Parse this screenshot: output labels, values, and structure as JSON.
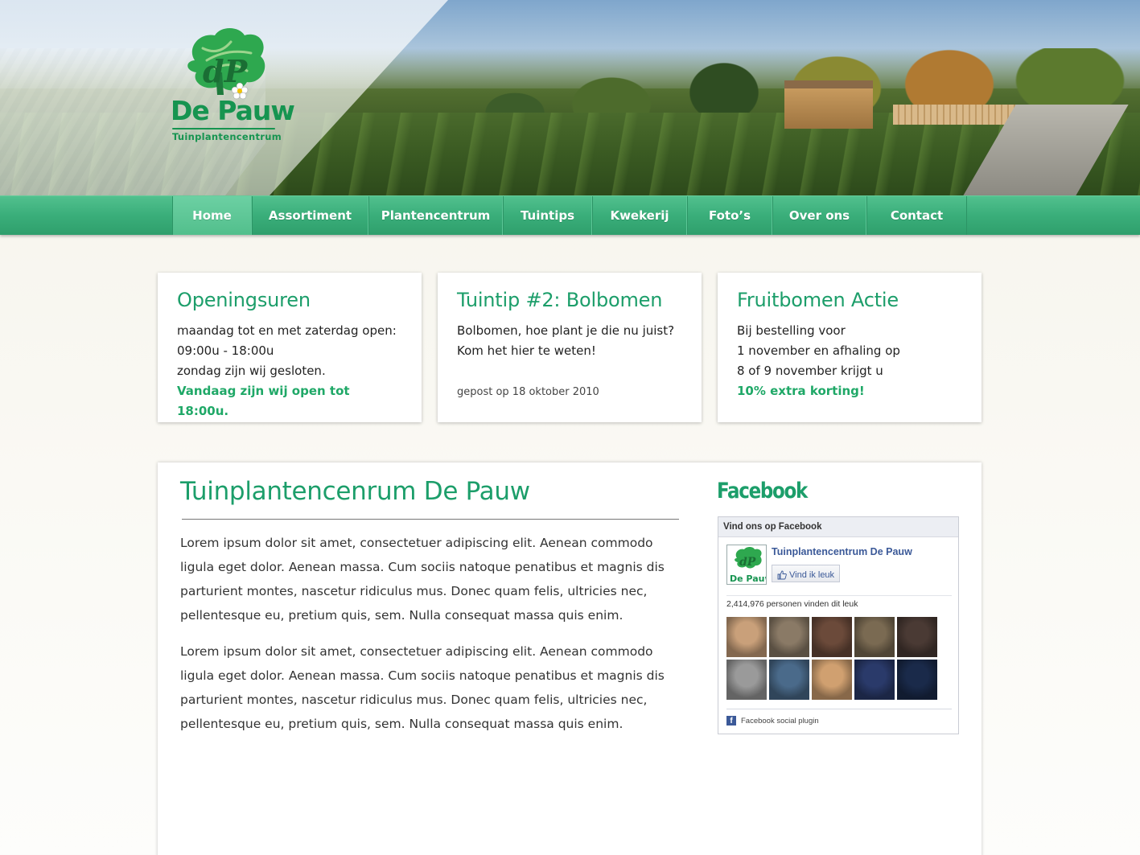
{
  "brand": {
    "name": "De Pauw",
    "subtitle": "Tuinplantencentrum",
    "monogram": "dP",
    "logo_icon": "tree-flower-logo-icon",
    "color": "#169450"
  },
  "nav": {
    "items": [
      {
        "label": "Home",
        "active": true
      },
      {
        "label": "Assortiment"
      },
      {
        "label": "Plantencentrum"
      },
      {
        "label": "Tuintips"
      },
      {
        "label": "Kwekerij"
      },
      {
        "label": "Foto’s"
      },
      {
        "label": "Over ons"
      },
      {
        "label": "Contact"
      }
    ],
    "color": "#3aae7a"
  },
  "cards": {
    "hours": {
      "title": "Openingsuren",
      "line1": "maandag tot en met zaterdag open:",
      "line2": "09:00u - 18:00u",
      "line3": "zondag zijn wij gesloten.",
      "highlight": "Vandaag zijn wij open tot 18:00u."
    },
    "tip": {
      "title": "Tuintip #2: Bolbomen",
      "line1": "Bolbomen, hoe plant je die nu juist?",
      "line2": "Kom het hier te weten!",
      "meta": "gepost op 18 oktober 2010"
    },
    "promo": {
      "title": "Fruitbomen Actie",
      "line1": "Bij bestelling voor",
      "line2": "1 november en afhaling op",
      "line3": "8 of 9 november krijgt u",
      "highlight": "10% extra korting!"
    }
  },
  "main": {
    "title": "Tuinplantencenrum De Pauw",
    "paragraphs": [
      "Lorem ipsum dolor sit amet, consectetuer adipiscing elit. Aenean commodo ligula eget dolor. Aenean massa. Cum sociis natoque penatibus et magnis dis parturient montes, nascetur ridiculus mus. Donec quam felis, ultricies nec, pellentesque eu, pretium quis, sem. Nulla consequat massa quis enim.",
      "Lorem ipsum dolor sit amet, consectetuer adipiscing elit. Aenean commodo ligula eget dolor. Aenean massa. Cum sociis natoque penatibus et magnis dis parturient montes, nascetur ridiculus mus. Donec quam felis, ultricies nec, pellentesque eu, pretium quis, sem. Nulla consequat massa quis enim."
    ]
  },
  "facebook": {
    "heading": "Facebook",
    "box_header": "Vind ons op Facebook",
    "page_name": "Tuinplantencentrum De Pauw",
    "like_label": "Vind ik leuk",
    "like_icon": "thumbs-up-icon",
    "count_text": "2,414,976 personen vinden dit leuk",
    "footer_text": "Facebook social plugin",
    "footer_icon": "facebook-f-icon",
    "face_colors": [
      "#c9a07a",
      "#8a7a66",
      "#6b4a3a",
      "#7a6a52",
      "#4a3a34",
      "#9a9a9a",
      "#4a6a8a",
      "#d0a070",
      "#2a3a6a",
      "#1a2a4a"
    ],
    "link_color": "#3b5998"
  }
}
